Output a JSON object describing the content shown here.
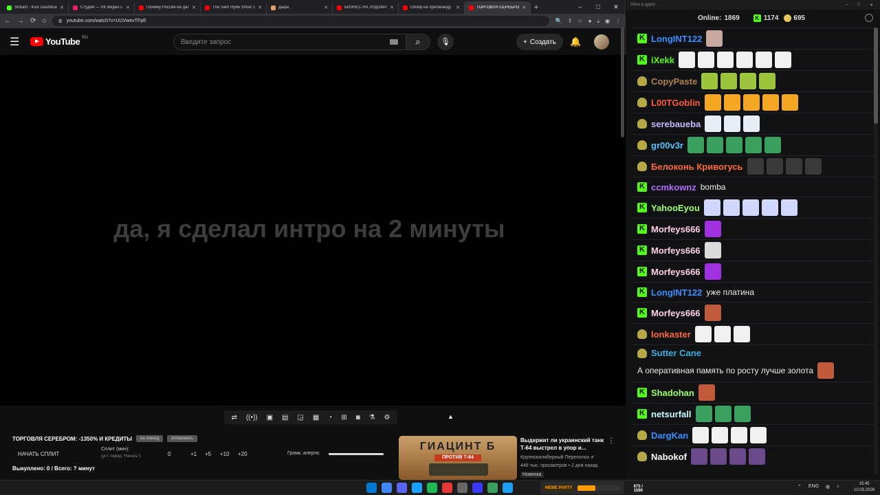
{
  "browser": {
    "tabs": [
      {
        "title": "Stream - Kick Dashboard",
        "favicon_color": "#53fc18",
        "active": false
      },
      {
        "title": "Студия — VK Видео Live",
        "favicon_color": "#e91e63",
        "active": false
      },
      {
        "title": "Почему России не далась",
        "favicon_color": "#ff0000",
        "active": false
      },
      {
        "title": "The Sam Hyde Show: D",
        "favicon_color": "#ff0000",
        "active": false
      },
      {
        "title": "Дыра",
        "favicon_color": "#e0a060",
        "active": false
      },
      {
        "title": "БИЗНЕС НА ЛУДОМАНА",
        "favicon_color": "#ff0000",
        "active": false
      },
      {
        "title": "Обзор на пропаганду",
        "favicon_color": "#ff0000",
        "active": false
      },
      {
        "title": "ТОРГОВЛЯ СЕРЕБРОМ",
        "favicon_color": "#ff0000",
        "active": true
      }
    ],
    "new_tab": "+",
    "url": "youtube.com/watch?v=UUVwevTFpE",
    "window_buttons": {
      "minimize": "–",
      "maximize": "□",
      "close": "✕"
    }
  },
  "youtube": {
    "logo_text": "YouTube",
    "region": "RU",
    "search_placeholder": "Введите запрос",
    "create_label": "Создать",
    "video_overlay_text": "да, я сделал интро на 2 минуты"
  },
  "panel": {
    "trade_title": "ТОРГОВЛЯ СЕРЕБРОМ: -1350% И КРЕДИТЫ",
    "pill1": "на эпизод",
    "pill2": "копировать",
    "start_split": "НАЧАТЬ СПЛИТ",
    "split_label": "Сплит (мин):",
    "split_hint": "(уст. перед \"Начать\")",
    "split_values": [
      "0",
      "+1",
      "+5",
      "+10",
      "+20"
    ],
    "alert_volume_label": "Громк. алерта:",
    "alert_volume": 1.0,
    "bought": "Выкуплено: 0 / Всего: ? минут"
  },
  "recommendation": {
    "thumb_title": "ГИАЦИНТ Б",
    "thumb_subtitle": "ПРОТИВ Т-64",
    "title": "Выдержит ли украинский танк Т-64 выстрел в упор и...",
    "channel": "Крупнокалиберный Переполох ✔",
    "meta": "446 тыс. просмотров • 2 дня назад",
    "badge": "Новинка",
    "menu": "⋮"
  },
  "chat": {
    "window_title": "Окно в дурку",
    "online_label": "Online:",
    "online_count": "1869",
    "kick_count": "1174",
    "coin_count": "695",
    "messages": [
      {
        "user": "LongINT122",
        "color": "#3b8fff",
        "badge": "k",
        "text": "",
        "emotes": [
          "#c9a8a0"
        ]
      },
      {
        "user": "iXekk",
        "color": "#53fc18",
        "badge": "k",
        "text": "",
        "emotes": [
          "#f0f0f0",
          "#f0f0f0",
          "#f0f0f0",
          "#f0f0f0",
          "#f0f0f0",
          "#f0f0f0"
        ]
      },
      {
        "user": "CopyPaste",
        "color": "#b08050",
        "badge": "frog",
        "text": "",
        "emotes": [
          "#9bc53d",
          "#9bc53d",
          "#9bc53d",
          "#9bc53d"
        ]
      },
      {
        "user": "L00TGoblin",
        "color": "#ff5a3c",
        "badge": "frog",
        "text": "",
        "emotes": [
          "#f5a623",
          "#f5a623",
          "#f5a623",
          "#f5a623",
          "#f5a623"
        ]
      },
      {
        "user": "serebaueba",
        "color": "#c7b8ff",
        "badge": "frog",
        "text": "",
        "emotes": [
          "#e8eef5",
          "#e8eef5",
          "#e8eef5"
        ]
      },
      {
        "user": "gr00v3r",
        "color": "#5fc0ff",
        "badge": "frog",
        "text": "",
        "emotes": [
          "#3aa060",
          "#3aa060",
          "#3aa060",
          "#3aa060",
          "#3aa060"
        ]
      },
      {
        "user": "Белоконь Кривогусь",
        "color": "#ff6a3d",
        "badge": "frog",
        "text": "",
        "emotes": [
          "#3a3a3a",
          "#3a3a3a",
          "#3a3a3a",
          "#3a3a3a"
        ]
      },
      {
        "user": "ccmkownz",
        "color": "#b06cff",
        "badge": "k",
        "text": "bomba",
        "emotes": []
      },
      {
        "user": "YahooEyou",
        "color": "#9dff6a",
        "badge": "k",
        "text": "",
        "emotes": [
          "#d0d8ff",
          "#d0d8ff",
          "#d0d8ff",
          "#d0d8ff",
          "#d0d8ff"
        ]
      },
      {
        "user": "Morfeys666",
        "color": "#ffd0e8",
        "badge": "k",
        "text": "",
        "emotes": [
          "#a030e0"
        ]
      },
      {
        "user": "Morfeys666",
        "color": "#ffd0e8",
        "badge": "k",
        "text": "",
        "emotes": [
          "#dcdcdc"
        ]
      },
      {
        "user": "Morfeys666",
        "color": "#ffd0e8",
        "badge": "k",
        "text": "",
        "emotes": [
          "#a030e0"
        ]
      },
      {
        "user": "LongINT122",
        "color": "#3b8fff",
        "badge": "k",
        "text": "уже платина",
        "emotes": []
      },
      {
        "user": "Morfeys666",
        "color": "#ffd0e8",
        "badge": "k",
        "text": "",
        "emotes": [
          "#c05a3a"
        ]
      },
      {
        "user": "lonkaster",
        "color": "#ff6a3d",
        "badge": "frog",
        "text": "",
        "emotes": [
          "#f0f0f0",
          "#f0f0f0",
          "#f0f0f0"
        ]
      },
      {
        "user": "Sutter Cane",
        "color": "#3bb0e0",
        "badge": "frog",
        "text": "А оперативная память по росту лучше золота",
        "emotes": [
          "#c05a3a"
        ]
      },
      {
        "user": "Shadohan",
        "color": "#9dff6a",
        "badge": "k",
        "text": "",
        "emotes": [
          "#c05a3a"
        ]
      },
      {
        "user": "netsurfall",
        "color": "#c8ffff",
        "badge": "k",
        "text": "",
        "emotes": [
          "#3aa060",
          "#3aa060",
          "#3aa060"
        ]
      },
      {
        "user": "DargKan",
        "color": "#3b8fff",
        "badge": "frog",
        "text": "",
        "emotes": [
          "#f0f0f0",
          "#f0f0f0",
          "#f0f0f0",
          "#f0f0f0"
        ]
      },
      {
        "user": "Nabokof",
        "color": "#ffffff",
        "badge": "frog",
        "text": "",
        "emotes": [
          "#6a4a8a",
          "#6a4a8a",
          "#6a4a8a",
          "#6a4a8a"
        ]
      }
    ]
  },
  "taskbar": {
    "meme_logo": "MEME PARTY",
    "meme_value": "675 / 1590",
    "meme_progress": 0.42,
    "lang": "ENG",
    "time": "15:45",
    "date": "10.03.2026",
    "icon_colors": [
      "#0078d4",
      "#4285f4",
      "#5865f2",
      "#1a9fff",
      "#1db954",
      "#e53935",
      "#666666",
      "#3a3aff",
      "#3aa060",
      "#1da1f2"
    ]
  }
}
